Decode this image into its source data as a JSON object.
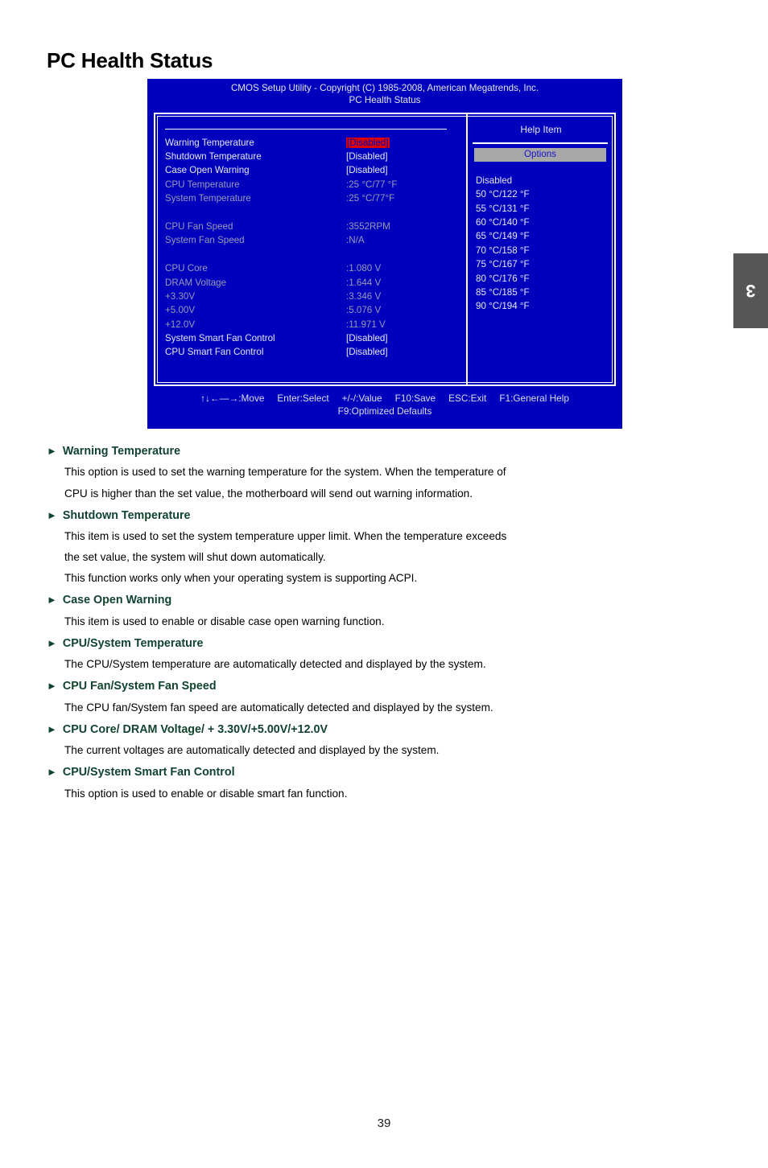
{
  "page": {
    "title": "PC Health Status",
    "number": "39",
    "chapter_tab": "3"
  },
  "bios": {
    "header_line1": "CMOS Setup Utility - Copyright (C) 1985-2008, American Megatrends, Inc.",
    "header_line2": "PC Health Status",
    "items": [
      {
        "label": "Warning Temperature",
        "value": "[Disabled]",
        "style": "bright",
        "highlight": true
      },
      {
        "label": "Shutdown Temperature",
        "value": "[Disabled]",
        "style": "bright",
        "highlight": false
      },
      {
        "label": "Case Open Warning",
        "value": "[Disabled]",
        "style": "bright",
        "highlight": false
      },
      {
        "label": "CPU Temperature",
        "value": ":25 °C/77 °F",
        "style": "dim",
        "highlight": false
      },
      {
        "label": "System Temperature",
        "value": ":25 °C/77°F",
        "style": "dim",
        "highlight": false
      },
      {
        "label": "",
        "value": "",
        "style": "spacer",
        "highlight": false
      },
      {
        "label": "CPU Fan Speed",
        "value": ":3552RPM",
        "style": "dim",
        "highlight": false
      },
      {
        "label": "System Fan Speed",
        "value": ":N/A",
        "style": "dim",
        "highlight": false
      },
      {
        "label": "",
        "value": "",
        "style": "spacer",
        "highlight": false
      },
      {
        "label": "CPU Core",
        "value": ":1.080 V",
        "style": "dim",
        "highlight": false
      },
      {
        "label": "DRAM Voltage",
        "value": ":1.644 V",
        "style": "dim",
        "highlight": false
      },
      {
        "label": "+3.30V",
        "value": ":3.346 V",
        "style": "dim",
        "highlight": false
      },
      {
        "label": "+5.00V",
        "value": ":5.076 V",
        "style": "dim",
        "highlight": false
      },
      {
        "label": "+12.0V",
        "value": ":11.971 V",
        "style": "dim",
        "highlight": false
      },
      {
        "label": "System Smart Fan Control",
        "value": "[Disabled]",
        "style": "bright",
        "highlight": false
      },
      {
        "label": "CPU Smart Fan Control",
        "value": "[Disabled]",
        "style": "bright",
        "highlight": false
      }
    ],
    "help": {
      "title": "Help Item",
      "options_label": "Options",
      "options": [
        "Disabled",
        "50 °C/122 °F",
        "55 °C/131 °F",
        "60 °C/140 °F",
        "65 °C/149 °F",
        "70 °C/158 °F",
        "75 °C/167 °F",
        "80 °C/176 °F",
        "85 °C/185 °F",
        "90 °C/194 °F"
      ]
    },
    "footer": {
      "keys": [
        "↑↓←—→:Move",
        "Enter:Select",
        "+/-/:Value",
        "F10:Save",
        "ESC:Exit",
        "F1:General Help"
      ],
      "row2": "F9:Optimized Defaults"
    },
    "colors": {
      "background": "#0000bd",
      "highlight_bg": "#e00000",
      "options_bar_bg": "#a8a8a8",
      "dim_text": "#9a9ab8",
      "bright_text": "#e6e6f2"
    }
  },
  "sections": [
    {
      "heading": "Warning Temperature",
      "paragraphs": [
        "This option is used to set the warning temperature for the system. When the temperature of",
        "CPU is higher than the set value, the motherboard will send out warning information."
      ]
    },
    {
      "heading": "Shutdown Temperature",
      "paragraphs": [
        "This item is used to set the system temperature upper limit. When the temperature exceeds",
        "the set value, the system will shut down automatically.",
        "This function works only when your operating system is supporting ACPI."
      ]
    },
    {
      "heading": "Case Open Warning",
      "paragraphs": [
        "This item is used to enable or disable case open warning function."
      ]
    },
    {
      "heading": "CPU/System Temperature",
      "paragraphs": [
        "The CPU/System temperature are automatically detected and displayed by the system."
      ]
    },
    {
      "heading": "CPU Fan/System Fan Speed",
      "paragraphs": [
        "The CPU fan/System fan speed are automatically detected and displayed by the system."
      ]
    },
    {
      "heading": "CPU Core/ DRAM Voltage/ + 3.30V/+5.00V/+12.0V",
      "paragraphs": [
        "The current voltages are automatically detected and displayed by the system."
      ]
    },
    {
      "heading": "CPU/System Smart Fan Control",
      "paragraphs": [
        "This option is used to enable or disable smart fan function."
      ]
    }
  ],
  "icons": {
    "section_arrow": "►"
  }
}
